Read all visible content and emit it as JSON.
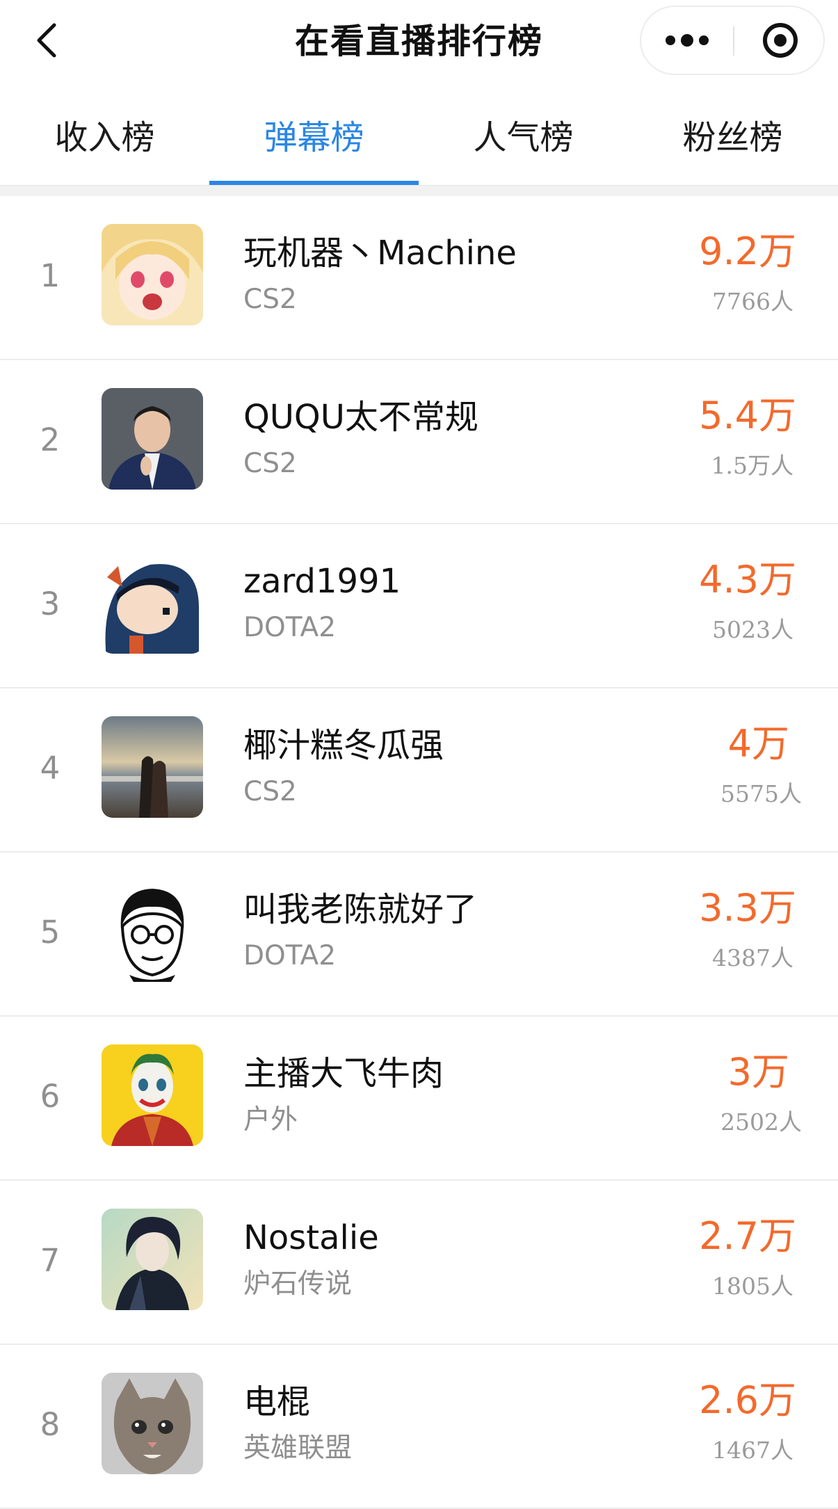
{
  "header": {
    "title": "在看直播排行榜",
    "back_icon": "chevron-left-icon",
    "more_icon": "more-dots-icon",
    "close_icon": "target-close-icon"
  },
  "tabs": [
    {
      "label": "收入榜",
      "active": false
    },
    {
      "label": "弹幕榜",
      "active": true
    },
    {
      "label": "人气榜",
      "active": false
    },
    {
      "label": "粉丝榜",
      "active": false
    }
  ],
  "colors": {
    "accent": "#2b86e3",
    "value": "#f26a2c",
    "muted": "#8f8f8f"
  },
  "rankings": [
    {
      "rank": "1",
      "name": "玩机器丶Machine",
      "category": "CS2",
      "value": "9.2万",
      "viewers": "7766人"
    },
    {
      "rank": "2",
      "name": "QUQU太不常规",
      "category": "CS2",
      "value": "5.4万",
      "viewers": "1.5万人"
    },
    {
      "rank": "3",
      "name": "zard1991",
      "category": "DOTA2",
      "value": "4.3万",
      "viewers": "5023人"
    },
    {
      "rank": "4",
      "name": "椰汁糕冬瓜强",
      "category": "CS2",
      "value": "4万",
      "viewers": "5575人"
    },
    {
      "rank": "5",
      "name": "叫我老陈就好了",
      "category": "DOTA2",
      "value": "3.3万",
      "viewers": "4387人"
    },
    {
      "rank": "6",
      "name": "主播大飞牛肉",
      "category": "户外",
      "value": "3万",
      "viewers": "2502人"
    },
    {
      "rank": "7",
      "name": "Nostalie",
      "category": "炉石传说",
      "value": "2.7万",
      "viewers": "1805人"
    },
    {
      "rank": "8",
      "name": "电棍",
      "category": "英雄联盟",
      "value": "2.6万",
      "viewers": "1467人"
    }
  ]
}
